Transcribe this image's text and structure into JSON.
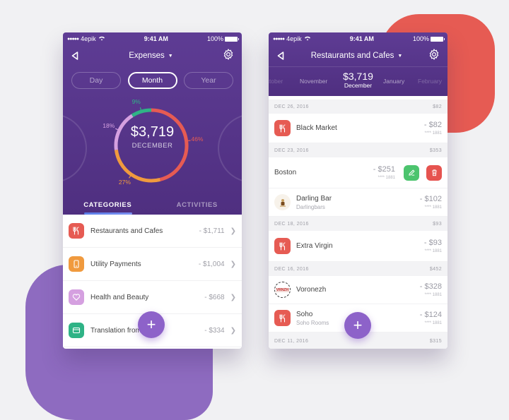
{
  "colors": {
    "purple_dark": "#4f2f80",
    "accent_red": "#e65b53",
    "accent_orange": "#f09a3e",
    "accent_lilac": "#d5a0e0",
    "accent_green": "#2fb386",
    "fab": "#8d62c9",
    "edit_green": "#4cc46e",
    "delete_red": "#e6534f"
  },
  "status_bar": {
    "carrier": "4epik",
    "time": "9:41 AM",
    "battery": "100%"
  },
  "left_screen": {
    "title": "Expenses",
    "periods": [
      {
        "label": "Day",
        "active": false
      },
      {
        "label": "Month",
        "active": true
      },
      {
        "label": "Year",
        "active": false
      }
    ],
    "total": "$3,719",
    "month": "DECEMBER",
    "tabs": [
      {
        "label": "CATEGORIES",
        "active": true
      },
      {
        "label": "ACTIVITIES",
        "active": false
      }
    ],
    "categories": [
      {
        "label": "Restaurants and Cafes",
        "amount": "- $1,711",
        "icon": "fork-knife-icon",
        "color": "#e65b53"
      },
      {
        "label": "Utility Payments",
        "amount": "- $1,004",
        "icon": "phone-icon",
        "color": "#f09a3e"
      },
      {
        "label": "Health and Beauty",
        "amount": "- $668",
        "icon": "heart-icon",
        "color": "#d5a0e0"
      },
      {
        "label": "Translation from card",
        "amount": "- $334",
        "icon": "card-icon",
        "color": "#2fb386"
      }
    ],
    "fab_label": "+"
  },
  "chart_data": {
    "type": "pie",
    "title": "$3,719 DECEMBER",
    "categories": [
      "Restaurants and Cafes",
      "Utility Payments",
      "Health and Beauty",
      "Translation from card"
    ],
    "values": [
      46,
      27,
      18,
      9
    ],
    "labels": [
      "46%",
      "27%",
      "18%",
      "9%"
    ],
    "colors": [
      "#e65b53",
      "#f09a3e",
      "#d5a0e0",
      "#2fb386"
    ]
  },
  "right_screen": {
    "title": "Restaurants and Cafes",
    "months": {
      "prev2": "October",
      "prev1": "November",
      "current_amount": "$3,719",
      "current_label": "December",
      "next1": "January",
      "next2": "February"
    },
    "groups": [
      {
        "date": "DEC 26, 2016",
        "total": "$82",
        "items": [
          {
            "name": "Black Market",
            "sub": "",
            "amount": "- $82",
            "card": "**** 1881",
            "icon": "fork-knife-icon"
          }
        ]
      },
      {
        "date": "DEC 23, 2016",
        "total": "$353",
        "items": [
          {
            "name": "Boston",
            "sub": "",
            "amount": "- $251",
            "card": "**** 1881",
            "icon": "",
            "swiped": true
          },
          {
            "name": "Darling Bar",
            "sub": "Darlingbars",
            "amount": "- $102",
            "card": "**** 1881",
            "icon": "darling-bar-logo"
          }
        ]
      },
      {
        "date": "DEC 18, 2016",
        "total": "$93",
        "items": [
          {
            "name": "Extra Virgin",
            "sub": "",
            "amount": "- $93",
            "card": "**** 1881",
            "icon": "fork-knife-icon"
          }
        ]
      },
      {
        "date": "DEC 16, 2016",
        "total": "$452",
        "items": [
          {
            "name": "Voronezh",
            "sub": "",
            "amount": "- $328",
            "card": "**** 1881",
            "icon": "voronezh-logo"
          },
          {
            "name": "Soho",
            "sub": "Soho Rooms",
            "amount": "- $124",
            "card": "**** 1881",
            "icon": "fork-knife-icon"
          }
        ]
      },
      {
        "date": "DEC 11, 2016",
        "total": "$315",
        "items": []
      }
    ],
    "fab_label": "+"
  }
}
